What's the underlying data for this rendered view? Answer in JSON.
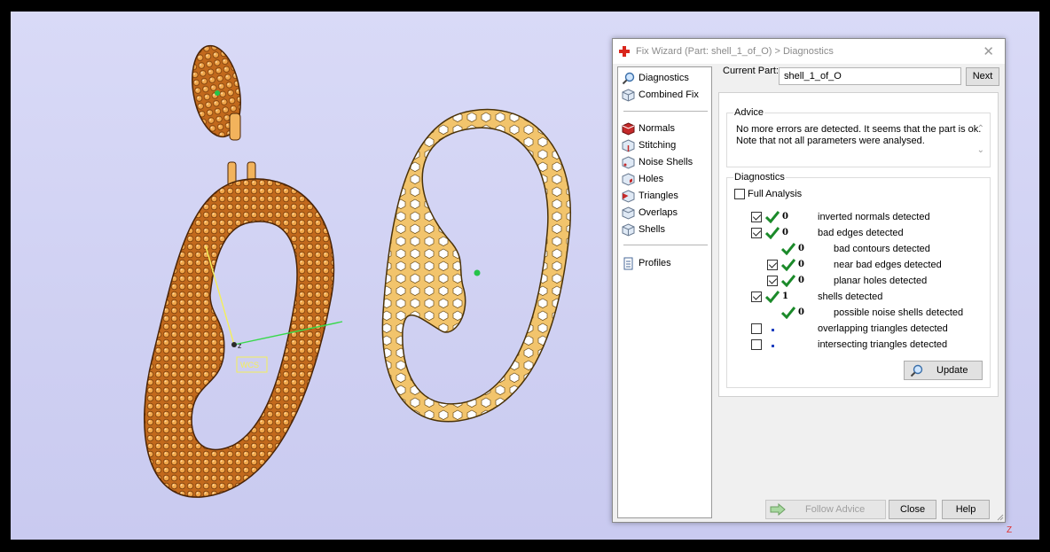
{
  "viewport": {
    "wcs_label": "WCS",
    "axis_z": "z",
    "corner_axis": "Z"
  },
  "dialog": {
    "title": "Fix Wizard (Part: shell_1_of_O) > Diagnostics",
    "close": "✕",
    "nav": [
      {
        "label": "Diagnostics",
        "icon": "magnifier-icon"
      },
      {
        "label": "Combined Fix",
        "icon": "cube-icon"
      },
      {
        "label": "Normals",
        "icon": "normals-cube-icon"
      },
      {
        "label": "Stitching",
        "icon": "stitching-cube-icon"
      },
      {
        "label": "Noise Shells",
        "icon": "noise-shells-icon"
      },
      {
        "label": "Holes",
        "icon": "holes-cube-icon"
      },
      {
        "label": "Triangles",
        "icon": "triangles-cube-icon"
      },
      {
        "label": "Overlaps",
        "icon": "overlaps-cube-icon"
      },
      {
        "label": "Shells",
        "icon": "shells-cube-icon"
      },
      {
        "label": "Profiles",
        "icon": "document-icon"
      }
    ],
    "current_part_label": "Current Part:",
    "current_part_value": "shell_1_of_O",
    "next_button": "Next",
    "advice_title": "Advice",
    "advice_line1": "No more errors are detected. It seems that the part is ok.",
    "advice_line2": "Note that not all parameters were analysed.",
    "diagnostics_title": "Diagnostics",
    "full_analysis": "Full Analysis",
    "rows": [
      {
        "text": "inverted normals detected",
        "count": "0",
        "checked": true,
        "indent": 0
      },
      {
        "text": "bad edges detected",
        "count": "0",
        "checked": true,
        "indent": 0
      },
      {
        "text": "bad contours detected",
        "count": "0",
        "checked": null,
        "indent": 1
      },
      {
        "text": "near bad edges detected",
        "count": "0",
        "checked": true,
        "indent": 1
      },
      {
        "text": "planar holes detected",
        "count": "0",
        "checked": true,
        "indent": 1
      },
      {
        "text": "shells detected",
        "count": "1",
        "checked": true,
        "indent": 0
      },
      {
        "text": "possible noise shells detected",
        "count": "0",
        "checked": null,
        "indent": 1
      },
      {
        "text": "overlapping triangles detected",
        "count": "",
        "checked": false,
        "indent": 0
      },
      {
        "text": "intersecting triangles detected",
        "count": "",
        "checked": false,
        "indent": 0
      }
    ],
    "update_button": "Update",
    "follow_advice_button": "Follow Advice",
    "close_button": "Close",
    "help_button": "Help"
  },
  "colors": {
    "gold": "#f2c46c",
    "orange": "#c96f1f",
    "accent_green": "#1b8a2a",
    "viewport_bg": "#d3d4f4"
  }
}
